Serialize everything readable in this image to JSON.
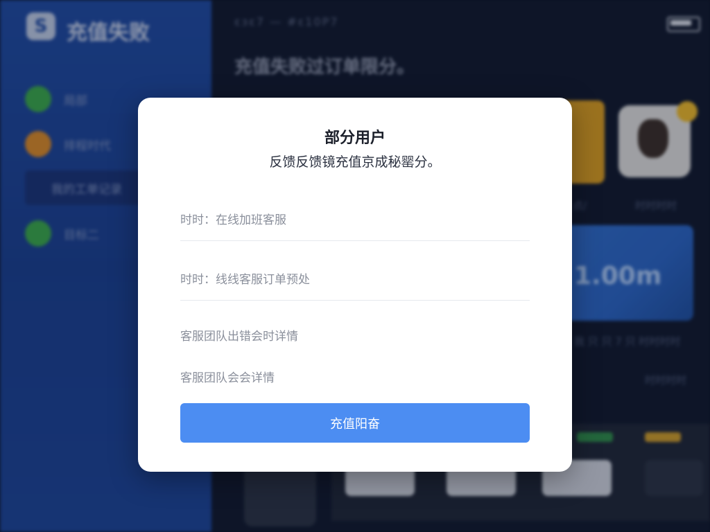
{
  "background": {
    "app_title": "充值失败",
    "sidebar_items": [
      {
        "label": "局部",
        "color": "#3aa54b"
      },
      {
        "label": "排程时代",
        "color": "#d4882a"
      },
      {
        "label": "我的工单记录",
        "color": ""
      },
      {
        "label": "目标二",
        "color": "#3aa54b"
      }
    ],
    "status_left": "ɛɜɛ7   —  #ɛ10P7",
    "main_heading": "充值失败过订单限分。",
    "card_amount": "1.00m",
    "card_caption_1": "点/",
    "card_caption_2": "时时时时",
    "caption_row": "我 只 只 7 只 时时时时",
    "legend_text": "时时时时"
  },
  "modal": {
    "title": "部分用户",
    "subtitle": "反馈反馈镜充值京成秘罂分。",
    "rows": [
      "时时：在线加班客服",
      "时时：线线客服订单预处",
      "客服团队出错会时详情",
      "客服团队会会详情"
    ],
    "button_label": "充值阳奋"
  },
  "colors": {
    "accent": "#4c8df2",
    "sidebar": "#1f4aa0",
    "modal_bg": "#ffffff"
  }
}
